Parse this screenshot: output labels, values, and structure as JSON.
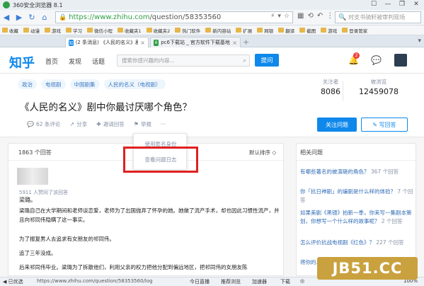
{
  "browser": {
    "title": "360安全浏览器 8.1",
    "window_controls": [
      "☐",
      "—",
      "❐",
      "✕"
    ],
    "url_host": "https://www.zhihu.com",
    "url_path": "/question/58353560",
    "search_placeholder": "时支书骑轩被审判现场",
    "bookmarks": [
      "收藏",
      "动漫",
      "游戏",
      "学习",
      "微信小程",
      "收藏夹1",
      "收藏夹2",
      "热门软件",
      "新内容站",
      "扩展",
      "网银",
      "翻译",
      "截图",
      "游戏",
      "登录管家"
    ],
    "tabs": [
      {
        "title": "(2 条消息) 《人民的名义》剧中你最...",
        "icon": "知",
        "active": true
      },
      {
        "title": "pc6下载站 _ 官方软件下载基地_最安...",
        "icon": "6",
        "active": false
      }
    ]
  },
  "zhihu": {
    "logo": "知乎",
    "nav": [
      "首页",
      "发现",
      "话题"
    ],
    "search_placeholder": "搜索你感兴趣的内容...",
    "ask_button": "提问",
    "notification_count": "2"
  },
  "question": {
    "topics": [
      "政治",
      "电视剧",
      "中国剧集",
      "人民的名义（电视剧）"
    ],
    "title": "《人民的名义》剧中你最讨厌哪个角色？",
    "followers_label": "关注者",
    "followers": "8086",
    "views_label": "被浏览",
    "views": "12459078",
    "actions": {
      "comments": "62 条评论",
      "share": "分享",
      "invite": "邀请回答",
      "report": "举报",
      "more": "···"
    },
    "follow_button": "关注问题",
    "write_button": "写回答"
  },
  "dropdown": {
    "items": [
      "使用匿名身份",
      "查看问题日志"
    ]
  },
  "answers": {
    "count": "1863 个回答",
    "sort": "默认排序 ◇",
    "likes_text": "5911 人赞同了该回答",
    "author": "梁璐。",
    "paragraphs": [
      "梁璐自己在大学期间和老师谈恋爱，老师为了出国抛弃了怀孕的她。她做了流产手术，却也因此习惯性流产，并且向祁同伟隐瞒了这一事实。",
      "为了报复男人去追求有女朋友的祁同伟。",
      "追了三年没成。",
      "后来祁同伟毕业。梁璐为了拆散他们，利用父亲的权力把他分配到偏远地区，把祁同伟的女朋友陈"
    ]
  },
  "related": {
    "title": "相关问题",
    "items": [
      {
        "q": "有哪些著名的被演砸的角色？",
        "c": "367 个回答"
      },
      {
        "q": "你「抗日神剧」的编剧是什么样的体验？",
        "c": "7 个回答"
      },
      {
        "q": "如果美剧《黑镜》拍新一季，你来写一集剧本策划，你想写一个什么样的故事呢？",
        "c": "2 个回答"
      },
      {
        "q": "怎么评价抗战电视剧《红色》？",
        "c": "227 个回答"
      },
      {
        "q": "将你的……",
        "c": ""
      }
    ]
  },
  "watermark": "JB51.CC",
  "statusbar": {
    "left": "◀ 已优选",
    "url": "https://www.zhihu.com/question/58353560/log",
    "items": [
      "今日直播",
      "推荐浏览",
      "加速器",
      "下载",
      "◎",
      "100%"
    ]
  }
}
